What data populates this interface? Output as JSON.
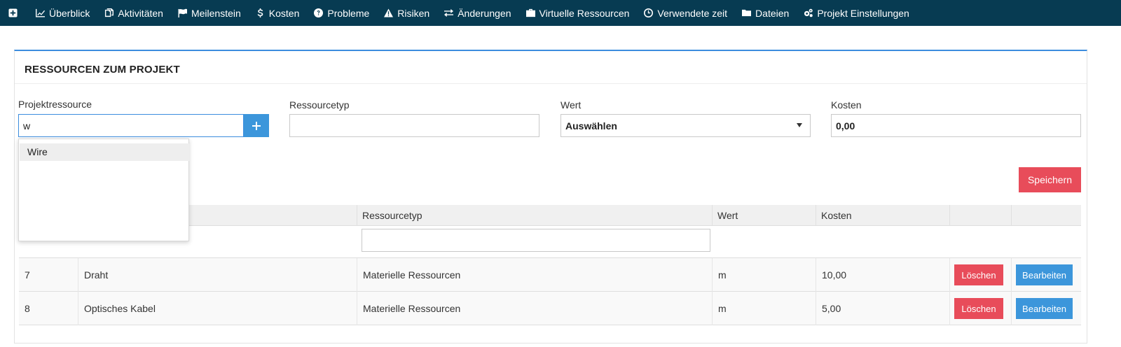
{
  "nav": {
    "items": [
      {
        "label": "Überblick",
        "icon": "chart-line-icon"
      },
      {
        "label": "Aktivitäten",
        "icon": "copy-icon"
      },
      {
        "label": "Meilenstein",
        "icon": "flag-icon"
      },
      {
        "label": "Kosten",
        "icon": "dollar-icon"
      },
      {
        "label": "Probleme",
        "icon": "question-circle-icon"
      },
      {
        "label": "Risiken",
        "icon": "warning-icon"
      },
      {
        "label": "Änderungen",
        "icon": "exchange-icon"
      },
      {
        "label": "Virtuelle Ressourcen",
        "icon": "briefcase-icon"
      },
      {
        "label": "Verwendete zeit",
        "icon": "clock-icon"
      },
      {
        "label": "Dateien",
        "icon": "folder-icon"
      },
      {
        "label": "Projekt Einstellungen",
        "icon": "gears-icon"
      }
    ]
  },
  "panel": {
    "title": "RESSOURCEN ZUM PROJEKT"
  },
  "form": {
    "projektressource": {
      "label": "Projektressource",
      "value": "w"
    },
    "ressourcetyp": {
      "label": "Ressourcetyp",
      "value": ""
    },
    "wert": {
      "label": "Wert",
      "selected": "Auswählen"
    },
    "kosten": {
      "label": "Kosten",
      "value": "0,00"
    },
    "save_label": "Speichern"
  },
  "autocomplete": {
    "options": [
      "Wire"
    ]
  },
  "table": {
    "headers": [
      "",
      "",
      "Ressourcetyp",
      "Wert",
      "Kosten",
      "",
      ""
    ],
    "rows": [
      {
        "id": "7",
        "name": "Draht",
        "typ": "Materielle Ressourcen",
        "wert": "m",
        "kosten": "10,00",
        "delete": "Löschen",
        "edit": "Bearbeiten"
      },
      {
        "id": "8",
        "name": "Optisches Kabel",
        "typ": "Materielle Ressourcen",
        "wert": "m",
        "kosten": "5,00",
        "delete": "Löschen",
        "edit": "Bearbeiten"
      }
    ]
  },
  "colors": {
    "nav_bg": "#073b52",
    "accent_blue": "#3c96db",
    "danger_red": "#e84c5a"
  }
}
